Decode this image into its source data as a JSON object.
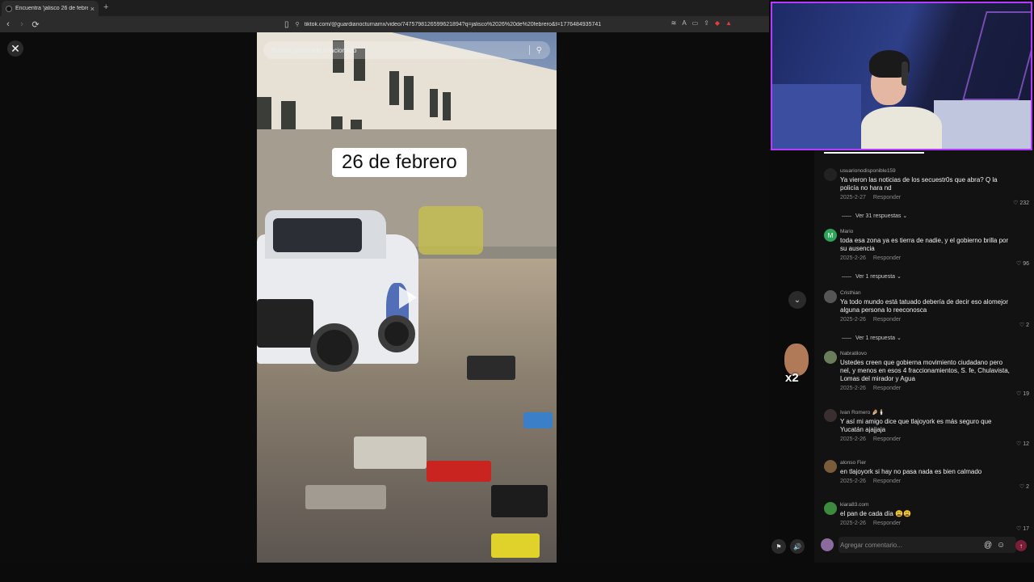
{
  "browser": {
    "tab_title": "Encuentra 'jalisco 26 de febrero'",
    "tab_close": "×",
    "new_tab": "+",
    "back": "‹",
    "forward": "›",
    "reload": "⟳",
    "url": "tiktok.com/@guardianocturnamx/video/7475798126599621894?q=jalisco%2026%20de%20febrero&t=1776484935741"
  },
  "video": {
    "search_placeholder": "Buscar contenido relacionado",
    "caption": "26 de febrero"
  },
  "overlay": {
    "close": "✕",
    "sticker_label": "x2"
  },
  "comments": [
    {
      "user": "usuarionodisponible159",
      "text": "Ya vieron las noticias de los secuestr0s que abra? Q la policía no hara nd",
      "date": "2025-2-27",
      "reply": "Responder",
      "likes": "232",
      "replies": "Ver 31 respuestas ⌄",
      "avatar": ""
    },
    {
      "user": "Mario",
      "text": "toda esa zona ya es tierra de nadie, y el gobierno brilla por su ausencia",
      "date": "2025-2-26",
      "reply": "Responder",
      "likes": "96",
      "replies": "Ver 1 respuesta ⌄",
      "avatar": "M"
    },
    {
      "user": "Cristhian",
      "text": "Ya todo mundo está tatuado debería de decir eso alomejor alguna persona lo reeconosca",
      "date": "2025-2-26",
      "reply": "Responder",
      "likes": "2",
      "replies": "Ver 1 respuesta ⌄",
      "avatar": ""
    },
    {
      "user": "Nabratilovo",
      "text": "Ustedes creen que gobierna movimiento ciudadano pero nel, y menos en esos 4 fraccionamientos, S. fe, Chulavista, Lomas del mirador y Agua",
      "date": "2025-2-26",
      "reply": "Responder",
      "likes": "19",
      "replies": "",
      "avatar": ""
    },
    {
      "user": "Ivan Romero 🤌🏼🕯️",
      "text": "Y así mi amigo dice que tlajoyork es más seguro que Yucatán ajajjaja",
      "date": "2025-2-26",
      "reply": "Responder",
      "likes": "12",
      "replies": "",
      "avatar": ""
    },
    {
      "user": "alonso Fier",
      "text": "en tlajoyork si hay no pasa nada es bien calmado",
      "date": "2025-2-26",
      "reply": "Responder",
      "likes": "2",
      "replies": "",
      "avatar": ""
    },
    {
      "user": "kiara83.com",
      "text": "el pan de cada día 😩😩",
      "date": "2025-2-26",
      "reply": "Responder",
      "likes": "17",
      "replies": "",
      "avatar": ""
    }
  ],
  "compose": {
    "placeholder": "Agregar comentario...",
    "at": "@",
    "emoji": "☺",
    "send": "↑"
  },
  "colors": {
    "accent": "#fe2c55",
    "webcam_border": "#b53cff"
  }
}
